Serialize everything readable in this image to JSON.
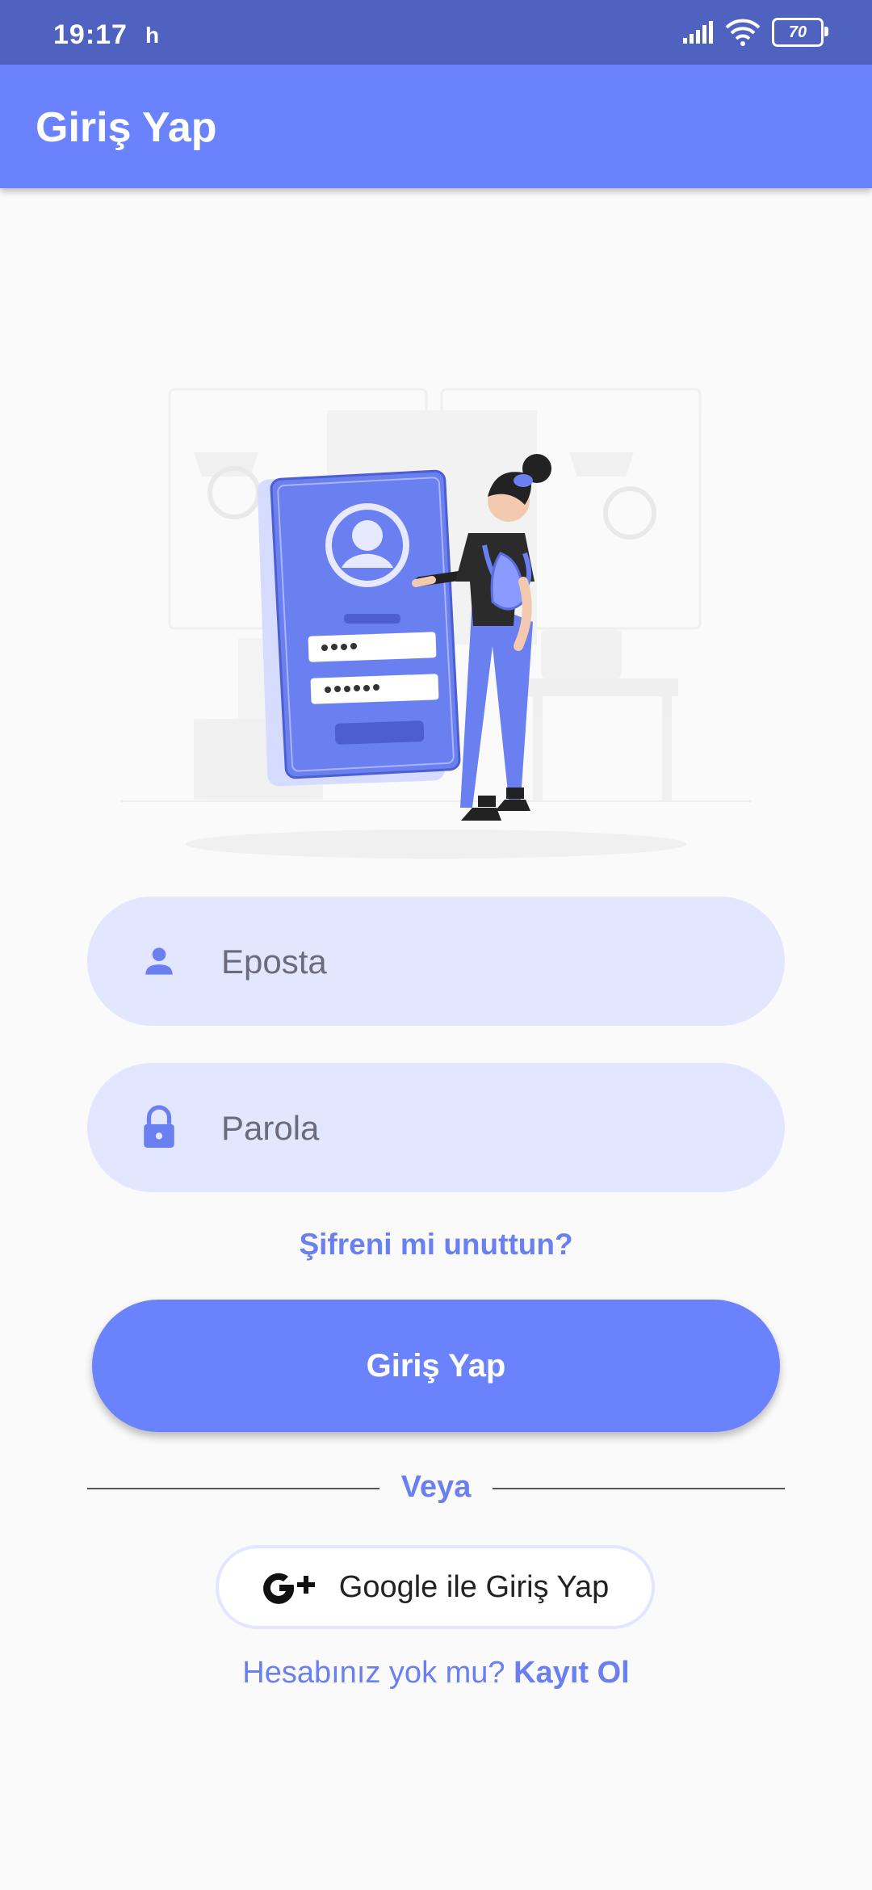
{
  "status_bar": {
    "time": "19:17",
    "indicator": "h",
    "battery": "70"
  },
  "app_bar": {
    "title": "Giriş Yap"
  },
  "form": {
    "email_placeholder": "Eposta",
    "password_placeholder": "Parola",
    "forgot_password": "Şifreni mi unuttun?",
    "login_button": "Giriş Yap"
  },
  "divider": "Veya",
  "google_button": "Google ile Giriş Yap",
  "register": {
    "prompt": "Hesabınız yok mu?",
    "link": "Kayıt Ol"
  },
  "colors": {
    "primary": "#6a82fb",
    "status_bar": "#5062c0",
    "field_bg": "#e2e6ff",
    "accent_text": "#6a7ff0"
  },
  "icons": [
    "signal-icon",
    "wifi-icon",
    "battery-icon",
    "person-icon",
    "lock-icon",
    "google-plus-icon"
  ]
}
